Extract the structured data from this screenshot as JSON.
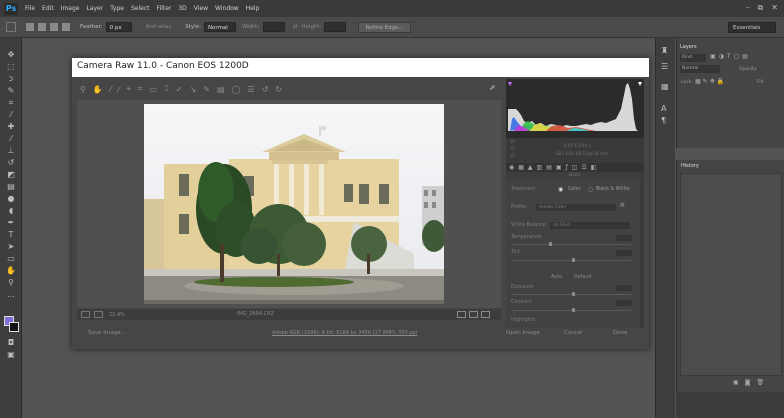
{
  "app": {
    "logo": "Ps"
  },
  "menu": [
    "File",
    "Edit",
    "Image",
    "Layer",
    "Type",
    "Select",
    "Filter",
    "3D",
    "View",
    "Window",
    "Help"
  ],
  "window_controls": [
    "–",
    "⧉",
    "✕"
  ],
  "options_bar": {
    "feather_label": "Feather:",
    "feather_value": "0 px",
    "antialias_label": "Anti-alias",
    "style_label": "Style:",
    "style_value": "Normal",
    "width_label": "Width:",
    "height_label": "Height:",
    "refine_button": "Refine Edge...",
    "workspace": "Essentials"
  },
  "camera_raw": {
    "title": "Camera Raw 11.0  -  Canon EOS 1200D",
    "zoom": "22.4%",
    "filename": "IMG_2694.CR2",
    "buttons": {
      "save": "Save Image...",
      "open": "Open Image",
      "cancel": "Cancel",
      "done": "Done"
    },
    "workflow_link": "Adobe RGB (1998); 8 bit; 5184 by 3456 (17.9MP); 300 ppi",
    "histogram_info": {
      "r": "R:",
      "g": "G:",
      "b": "B:",
      "line1": "f/10   1/200 s",
      "line2": "ISO 100   18-55@18 mm"
    },
    "basic": {
      "header": "Basic",
      "treatment_label": "Treatment:",
      "color": "Color",
      "bw": "Black & White",
      "profile_label": "Profile:",
      "profile_value": "Adobe Color",
      "wb_label": "White Balance:",
      "wb_value": "As Shot",
      "temperature": "Temperature",
      "tint": "Tint",
      "auto": "Auto",
      "default": "Default",
      "exposure": "Exposure",
      "contrast": "Contrast",
      "highlights": "Highlights"
    }
  },
  "layers_panel": {
    "tab": "Layers",
    "kind": "Kind",
    "blend": "Normal",
    "opacity_label": "Opacity:",
    "lock_label": "Lock:",
    "fill_label": "Fill:"
  },
  "history_panel": {
    "tab": "History"
  }
}
